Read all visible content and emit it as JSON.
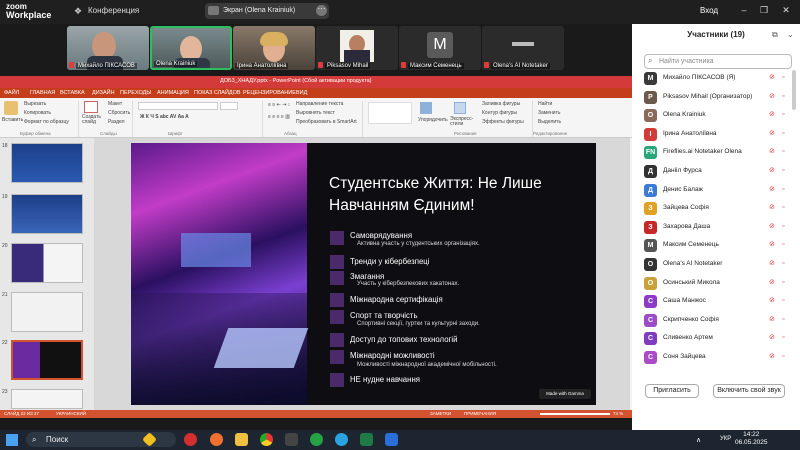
{
  "zoom": {
    "logo_line1": "zoom",
    "logo_line2": "Workplace",
    "conference": "Конференция",
    "share_label": "Экран (Olena Krainiuk)",
    "login": "Вход"
  },
  "videos": [
    {
      "name": "Михайло ПІКСАСОВ"
    },
    {
      "name": "Olena Krainiuk"
    },
    {
      "name": "Ірина Анатоліївна"
    },
    {
      "name": "Piksasov Mihail"
    },
    {
      "name": "Максим Семенець",
      "initial": "M"
    },
    {
      "name": "Olena's AI Notetaker"
    }
  ],
  "participants": {
    "title": "Участники (19)",
    "search_placeholder": "Найти участника",
    "list": [
      {
        "name": "Михайло ПІКСАСОВ (Я)",
        "initial": "M",
        "color": "#3a3a3a"
      },
      {
        "name": "Piksasov Mihail (Организатор)",
        "initial": "P",
        "color": "#6b5a4a"
      },
      {
        "name": "Olena Krainiuk",
        "initial": "O",
        "color": "#8a6a5a"
      },
      {
        "name": "Ірина Анатоліївна",
        "initial": "I",
        "color": "#d33b3b"
      },
      {
        "name": "Fireflies.ai Notetaker Olena",
        "initial": "FN",
        "color": "#2aa57a"
      },
      {
        "name": "Данііл Фурса",
        "initial": "Д",
        "color": "#333"
      },
      {
        "name": "Денис Балаж",
        "initial": "Д",
        "color": "#3a7bd5"
      },
      {
        "name": "Зайцева Софія",
        "initial": "З",
        "color": "#e0a020"
      },
      {
        "name": "Захарова Даша",
        "initial": "З",
        "color": "#c62828"
      },
      {
        "name": "Максим Семенець",
        "initial": "M",
        "color": "#555"
      },
      {
        "name": "Olena's AI Notetaker",
        "initial": "O",
        "color": "#333"
      },
      {
        "name": "Осинський Микола",
        "initial": "O",
        "color": "#c9a33a"
      },
      {
        "name": "Саша Манжос",
        "initial": "С",
        "color": "#8e3cc8"
      },
      {
        "name": "Скрипченко Софія",
        "initial": "С",
        "color": "#9b4cc8"
      },
      {
        "name": "Сливенко Артем",
        "initial": "С",
        "color": "#7e3cc0"
      },
      {
        "name": "Соня Зайцева",
        "initial": "С",
        "color": "#aa4cc8"
      }
    ],
    "invite": "Пригласить",
    "unmute": "Включить свой звук"
  },
  "ppt": {
    "title": "ДОБ3_ХНАДУ.pptx  -  PowerPoint (Сбой активации продукта)",
    "tabs": [
      "ФАЙЛ",
      "ГЛАВНАЯ",
      "ВСТАВКА",
      "ДИЗАЙН",
      "ПЕРЕХОДЫ",
      "АНИМАЦИЯ",
      "ПОКАЗ СЛАЙДОВ",
      "РЕЦЕНЗИРОВАНИЕ",
      "ВИД"
    ],
    "ribbon": {
      "paste": "Вставить",
      "cut": "Вырезать",
      "copy": "Копировать",
      "format": "Формат по образцу",
      "clipboard": "Буфер обмена",
      "create": "Создать слайд",
      "layout": "Макет",
      "reset": "Сбросить",
      "section": "Раздел",
      "slides": "Слайды",
      "font": "Шрифт",
      "paragraph": "Абзац",
      "text_dir": "Направление текста",
      "align_text": "Выровнять текст",
      "smartart": "Преобразовать в SmartArt",
      "arrange": "Упорядочить",
      "quick_styles": "Экспресс-стили",
      "fill": "Заливка фигуры",
      "outline": "Контур фигуры",
      "effects": "Эффекты фигуры",
      "drawing": "Рисование",
      "find": "Найти",
      "replace": "Заменить",
      "select": "Выделить",
      "editing": "Редактирование"
    },
    "thumb_numbers": [
      "18",
      "19",
      "20",
      "21",
      "22",
      "23"
    ],
    "slide": {
      "title": "Студентське Життя: Не Лише Навчанням Єдиним!",
      "bullets": [
        {
          "t": "Самоврядування",
          "s": "Активна участь у студентських організаціях."
        },
        {
          "t": "Тренди у кібербезпеці",
          "s": ""
        },
        {
          "t": "Змагання",
          "s": "Участь у кібербезпекових хакатонах."
        },
        {
          "t": "Міжнародна сертифікація",
          "s": ""
        },
        {
          "t": "Спорт та творчість",
          "s": "Спортивні секції, гуртки та культурні заходи."
        },
        {
          "t": "Доступ до топових технологій",
          "s": ""
        },
        {
          "t": "Міжнародні можливості",
          "s": "Можливості міжнародної академічної мобільності."
        },
        {
          "t": "НЕ нудне навчання",
          "s": ""
        }
      ],
      "badge": "Made with Gamma"
    },
    "status_left": "СЛАЙД 22 ИЗ 27",
    "status_lang": "УКРАИНСКИЙ",
    "status_notes": "ЗАМЕТКИ",
    "status_comments": "ПРИМЕЧАНИЯ",
    "zoom": "74 %"
  },
  "taskbar": {
    "search": "Поиск",
    "lang": "УКР",
    "time": "14:22",
    "date": "06.05.2025"
  }
}
